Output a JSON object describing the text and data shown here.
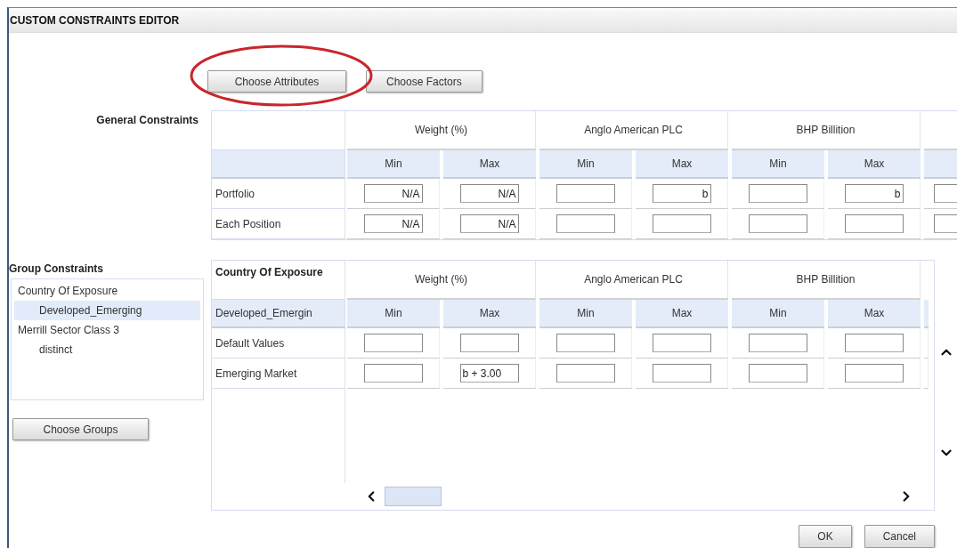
{
  "window": {
    "title": "CUSTOM CONSTRAINTS EDITOR"
  },
  "toolbar_buttons": [
    {
      "label": "Choose Attributes",
      "highlighted": true
    },
    {
      "label": "Choose Factors",
      "highlighted": false
    }
  ],
  "general_constraints": {
    "title": "General Constraints",
    "columns": [
      "Weight (%)",
      "Anglo American PLC",
      "BHP Billition"
    ],
    "subheaders": [
      "Min",
      "Max",
      "Min",
      "Max",
      "Min",
      "Max"
    ],
    "rows": [
      {
        "label": "Portfolio",
        "values": [
          {
            "kind": "field",
            "value": "N/A"
          },
          {
            "kind": "field",
            "value": "N/A"
          },
          {
            "kind": "field"
          },
          {
            "kind": "field",
            "value": "b"
          },
          {
            "kind": "field"
          },
          {
            "kind": "field",
            "value": "b"
          },
          {
            "kind": "field"
          }
        ]
      },
      {
        "label": "Each Position",
        "values": [
          {
            "kind": "field",
            "value": "N/A"
          },
          {
            "kind": "field",
            "value": "N/A"
          },
          {
            "kind": "field"
          },
          {
            "kind": "field"
          },
          {
            "kind": "field"
          },
          {
            "kind": "field"
          },
          {
            "kind": "field"
          }
        ]
      }
    ]
  },
  "group_constraints": {
    "title": "Group Constraints",
    "items": [
      {
        "label": "Country Of Exposure",
        "selected": false,
        "children": [
          {
            "label": "Developed_Emerging",
            "selected": true
          }
        ]
      },
      {
        "label": "Merrill Sector Class 3",
        "selected": false,
        "children": [
          {
            "label": "distinct",
            "selected": false
          }
        ]
      }
    ],
    "choose_button": "Choose Groups"
  },
  "group_table": {
    "corner": "Country Of Exposure",
    "group": "Developed_Emergin",
    "columns": [
      "Weight (%)",
      "Anglo American PLC",
      "BHP Billition"
    ],
    "subheaders": [
      "Min",
      "Max",
      "Min",
      "Max",
      "Min",
      "Max"
    ],
    "rows": [
      {
        "label": "Default Values",
        "values": [
          {
            "kind": "field"
          },
          {
            "kind": "field"
          },
          {
            "kind": "field"
          },
          {
            "kind": "field"
          },
          {
            "kind": "field"
          },
          {
            "kind": "field"
          }
        ]
      },
      {
        "label": "Emerging Market",
        "values": [
          {
            "kind": "field"
          },
          {
            "kind": "field",
            "value": "b + 3.00"
          },
          {
            "kind": "field"
          },
          {
            "kind": "field"
          },
          {
            "kind": "field"
          },
          {
            "kind": "field"
          }
        ]
      }
    ]
  },
  "footer_buttons": [
    "OK",
    "Cancel"
  ]
}
